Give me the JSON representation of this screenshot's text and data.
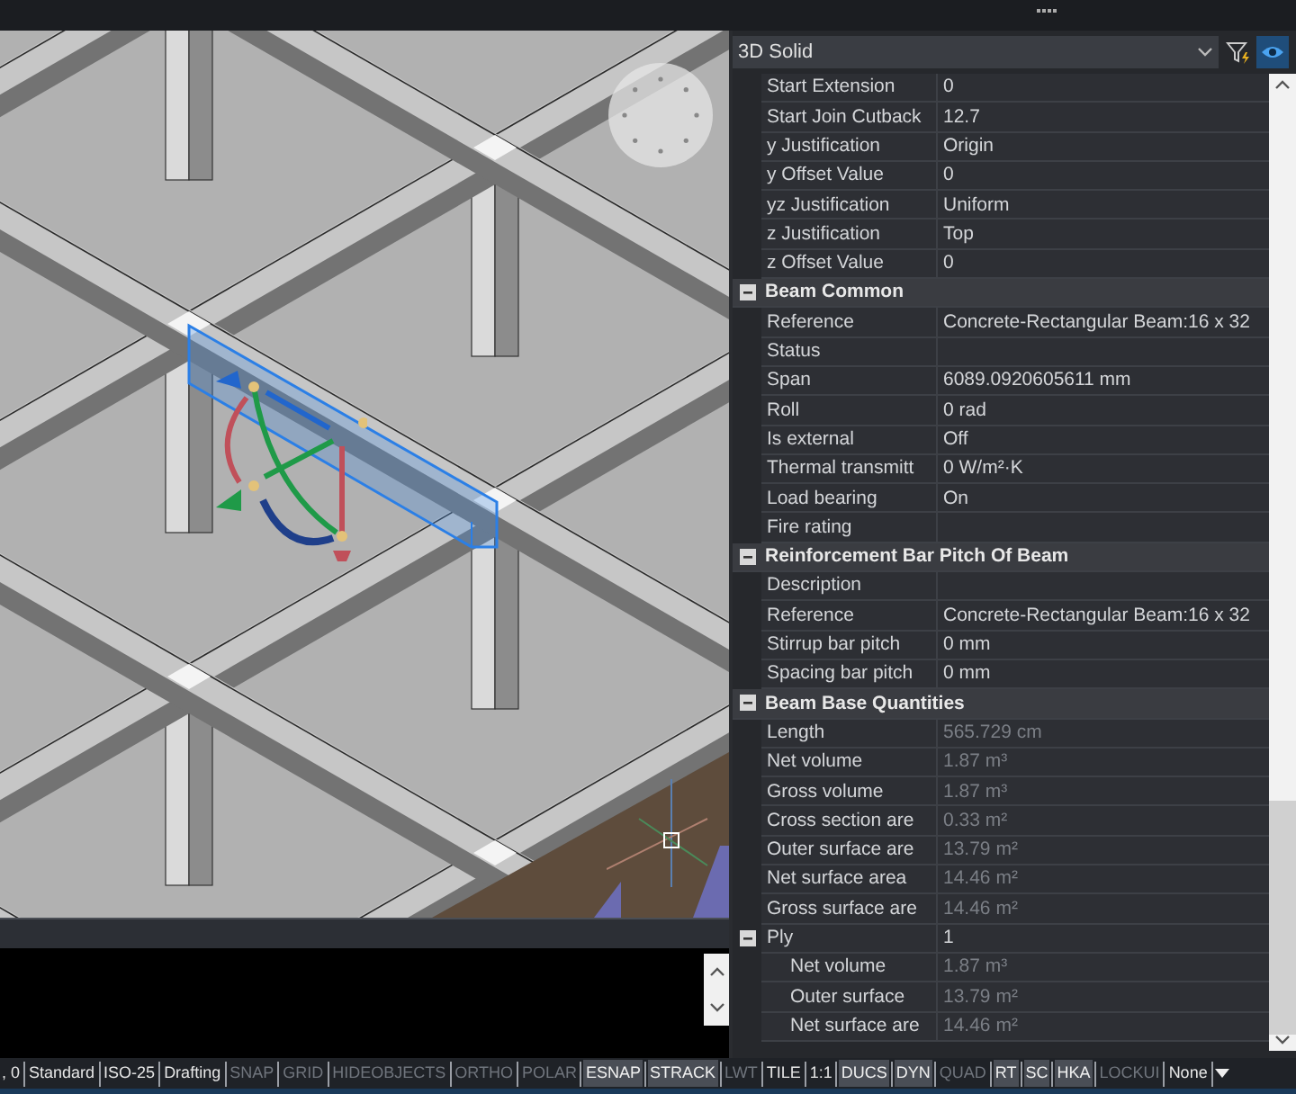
{
  "properties": {
    "selector": {
      "value": "3D Solid"
    },
    "rows": [
      {
        "label": "Start Extension",
        "value": "0",
        "readonly": false
      },
      {
        "label": "Start Join Cutback",
        "value": "12.7",
        "readonly": false
      },
      {
        "label": "y Justification",
        "value": "Origin",
        "readonly": false
      },
      {
        "label": "y Offset Value",
        "value": "0",
        "readonly": false
      },
      {
        "label": "yz Justification",
        "value": "Uniform",
        "readonly": false
      },
      {
        "label": "z Justification",
        "value": "Top",
        "readonly": false
      },
      {
        "label": "z Offset Value",
        "value": "0",
        "readonly": false
      }
    ],
    "sections": [
      {
        "title": "Beam Common",
        "expanded": true,
        "rows": [
          {
            "label": "Reference",
            "value": "Concrete-Rectangular Beam:16 x 32",
            "readonly": false
          },
          {
            "label": "Status"
          },
          {
            "label": "Span",
            "value": "6089.0920605611 mm",
            "readonly": false
          },
          {
            "label": "Roll",
            "value": "0 rad",
            "readonly": false
          },
          {
            "label": "Is external",
            "value": "Off",
            "readonly": false
          },
          {
            "label": "Thermal transmitt",
            "value": "0 W/m²·K",
            "readonly": false
          },
          {
            "label": "Load bearing",
            "value": "On",
            "readonly": false
          },
          {
            "label": "Fire rating"
          }
        ]
      },
      {
        "title": "Reinforcement Bar Pitch Of Beam",
        "expanded": true,
        "rows": [
          {
            "label": "Description"
          },
          {
            "label": "Reference",
            "value": "Concrete-Rectangular Beam:16 x 32",
            "readonly": false
          },
          {
            "label": "Stirrup bar pitch",
            "value": "0 mm",
            "readonly": false
          },
          {
            "label": "Spacing bar pitch",
            "value": "0 mm",
            "readonly": false
          }
        ]
      },
      {
        "title": "Beam Base Quantities",
        "expanded": true,
        "rows": [
          {
            "label": "Length",
            "value": "565.729 cm",
            "readonly": true
          },
          {
            "label": "Net volume",
            "value": "1.87 m³",
            "readonly": true
          },
          {
            "label": "Gross volume",
            "value": "1.87 m³",
            "readonly": true
          },
          {
            "label": "Cross section are",
            "value": "0.33 m²",
            "readonly": true
          },
          {
            "label": "Outer surface are",
            "value": "13.79 m²",
            "readonly": true
          },
          {
            "label": "Net surface area",
            "value": "14.46 m²",
            "readonly": true
          },
          {
            "label": "Gross surface are",
            "value": "14.46 m²",
            "readonly": true
          },
          {
            "label": "Ply",
            "value": "1",
            "readonly": false,
            "expanded": true,
            "children": [
              {
                "label": "Net volume",
                "value": "1.87 m³",
                "readonly": true
              },
              {
                "label": "Outer surface",
                "value": "13.79 m²",
                "readonly": true
              },
              {
                "label": "Net surface are",
                "value": "14.46 m²",
                "readonly": true
              }
            ]
          }
        ]
      }
    ]
  },
  "status_bar": {
    "items": [
      {
        "kind": "label",
        "text": ", 0"
      },
      {
        "kind": "label",
        "text": "Standard"
      },
      {
        "kind": "label",
        "text": "ISO-25"
      },
      {
        "kind": "label",
        "text": "Drafting"
      },
      {
        "kind": "toggle",
        "text": "SNAP",
        "on": false
      },
      {
        "kind": "toggle",
        "text": "GRID",
        "on": false
      },
      {
        "kind": "toggle",
        "text": "HIDEOBJECTS",
        "on": false
      },
      {
        "kind": "toggle",
        "text": "ORTHO",
        "on": false
      },
      {
        "kind": "toggle",
        "text": "POLAR",
        "on": false
      },
      {
        "kind": "toggle",
        "text": "ESNAP",
        "on": true
      },
      {
        "kind": "toggle",
        "text": "STRACK",
        "on": true
      },
      {
        "kind": "toggle",
        "text": "LWT",
        "on": false
      },
      {
        "kind": "label",
        "text": "TILE"
      },
      {
        "kind": "label",
        "text": "1:1"
      },
      {
        "kind": "toggle",
        "text": "DUCS",
        "on": true
      },
      {
        "kind": "toggle",
        "text": "DYN",
        "on": true
      },
      {
        "kind": "toggle",
        "text": "QUAD",
        "on": false
      },
      {
        "kind": "toggle",
        "text": "RT",
        "on": true
      },
      {
        "kind": "toggle",
        "text": "SC",
        "on": true
      },
      {
        "kind": "toggle",
        "text": "HKA",
        "on": true
      },
      {
        "kind": "toggle",
        "text": "LOCKUI",
        "on": false
      },
      {
        "kind": "label",
        "text": "None"
      }
    ]
  }
}
